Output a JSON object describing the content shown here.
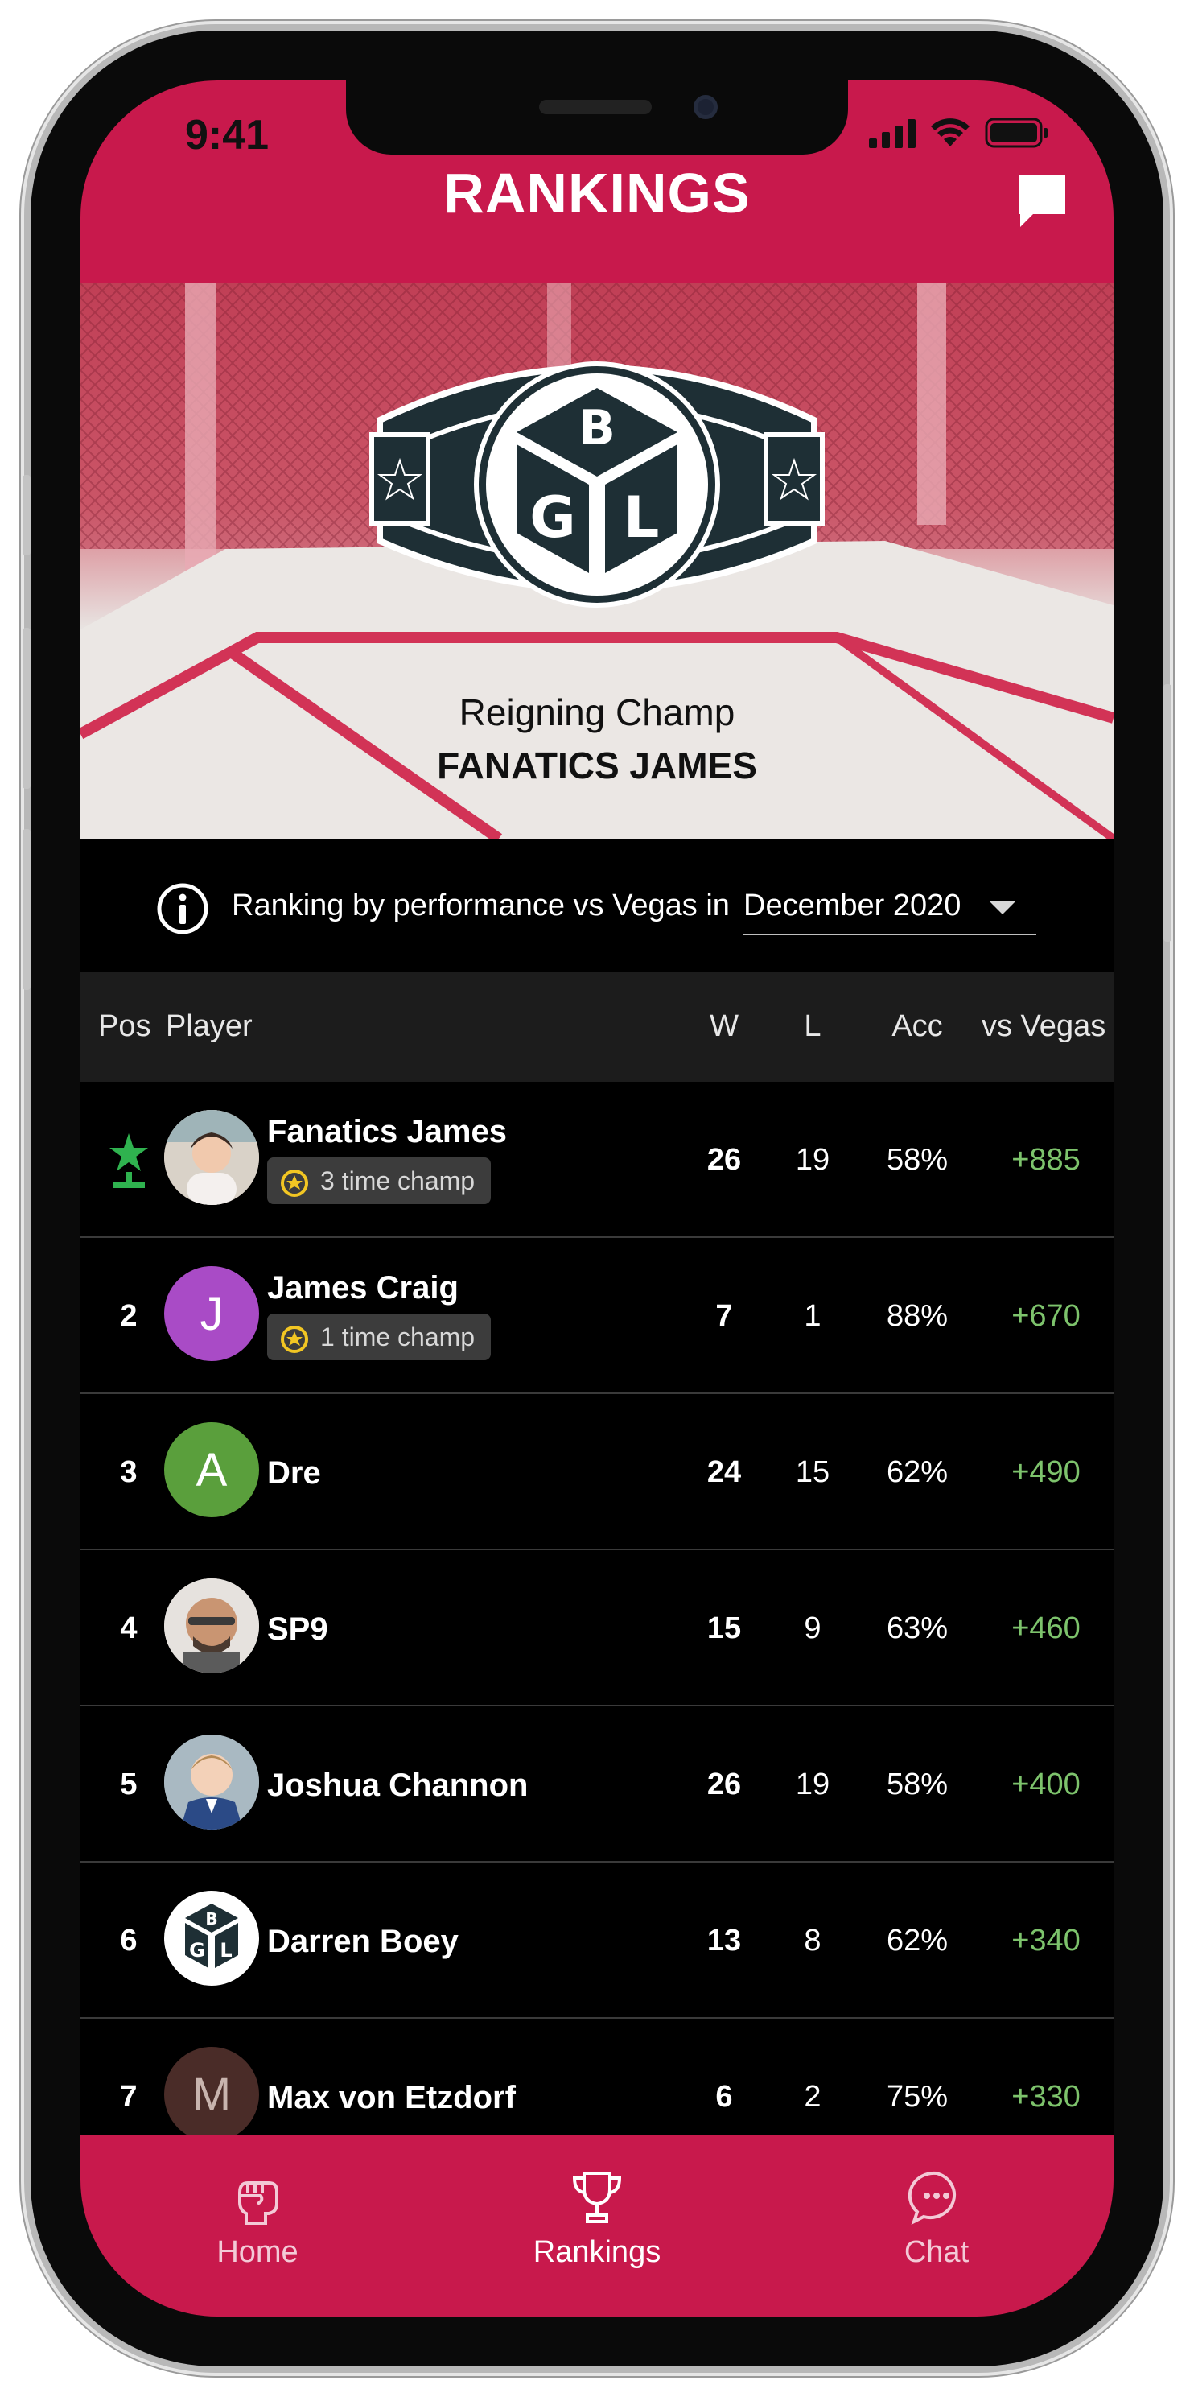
{
  "status_bar": {
    "time": "9:41"
  },
  "header": {
    "title": "RANKINGS",
    "chat_icon": "chat-bubble-icon"
  },
  "hero": {
    "logo_text": "BGL",
    "line1": "Reigning Champ",
    "line2": "FANATICS JAMES"
  },
  "filter": {
    "label": "Ranking by performance vs Vegas in",
    "selected_month": "December 2020"
  },
  "table": {
    "columns": {
      "pos": "Pos",
      "player": "Player",
      "w": "W",
      "l": "L",
      "acc": "Acc",
      "vs": "vs Vegas"
    },
    "rows": [
      {
        "pos": "",
        "pos_icon": "star-leader-icon",
        "name": "Fanatics James",
        "badge": "3 time champ",
        "avatar": "photo",
        "w": "26",
        "l": "19",
        "acc": "58%",
        "vs": "+885"
      },
      {
        "pos": "2",
        "name": "James Craig",
        "badge": "1 time champ",
        "avatar": "letter",
        "initial": "J",
        "avatar_color": "#a94bc6",
        "w": "7",
        "l": "1",
        "acc": "88%",
        "vs": "+670"
      },
      {
        "pos": "3",
        "name": "Dre",
        "avatar": "letter",
        "initial": "A",
        "avatar_color": "#5a9f3c",
        "w": "24",
        "l": "15",
        "acc": "62%",
        "vs": "+490"
      },
      {
        "pos": "4",
        "name": "SP9",
        "avatar": "photo",
        "w": "15",
        "l": "9",
        "acc": "63%",
        "vs": "+460"
      },
      {
        "pos": "5",
        "name": "Joshua Channon",
        "avatar": "photo",
        "w": "26",
        "l": "19",
        "acc": "58%",
        "vs": "+400"
      },
      {
        "pos": "6",
        "name": "Darren Boey",
        "avatar": "logo",
        "w": "13",
        "l": "8",
        "acc": "62%",
        "vs": "+340"
      },
      {
        "pos": "7",
        "name": "Max von Etzdorf",
        "avatar": "letter",
        "initial": "M",
        "avatar_color": "#4a2c28",
        "w": "6",
        "l": "2",
        "acc": "75%",
        "vs": "+330"
      }
    ]
  },
  "bottom_nav": {
    "items": [
      {
        "label": "Home",
        "icon": "fist-icon"
      },
      {
        "label": "Rankings",
        "icon": "trophy-icon",
        "active": true
      },
      {
        "label": "Chat",
        "icon": "chat-dots-icon"
      }
    ]
  },
  "colors": {
    "brand": "#c8194c",
    "positive": "#7dc36c",
    "background": "#000000"
  }
}
